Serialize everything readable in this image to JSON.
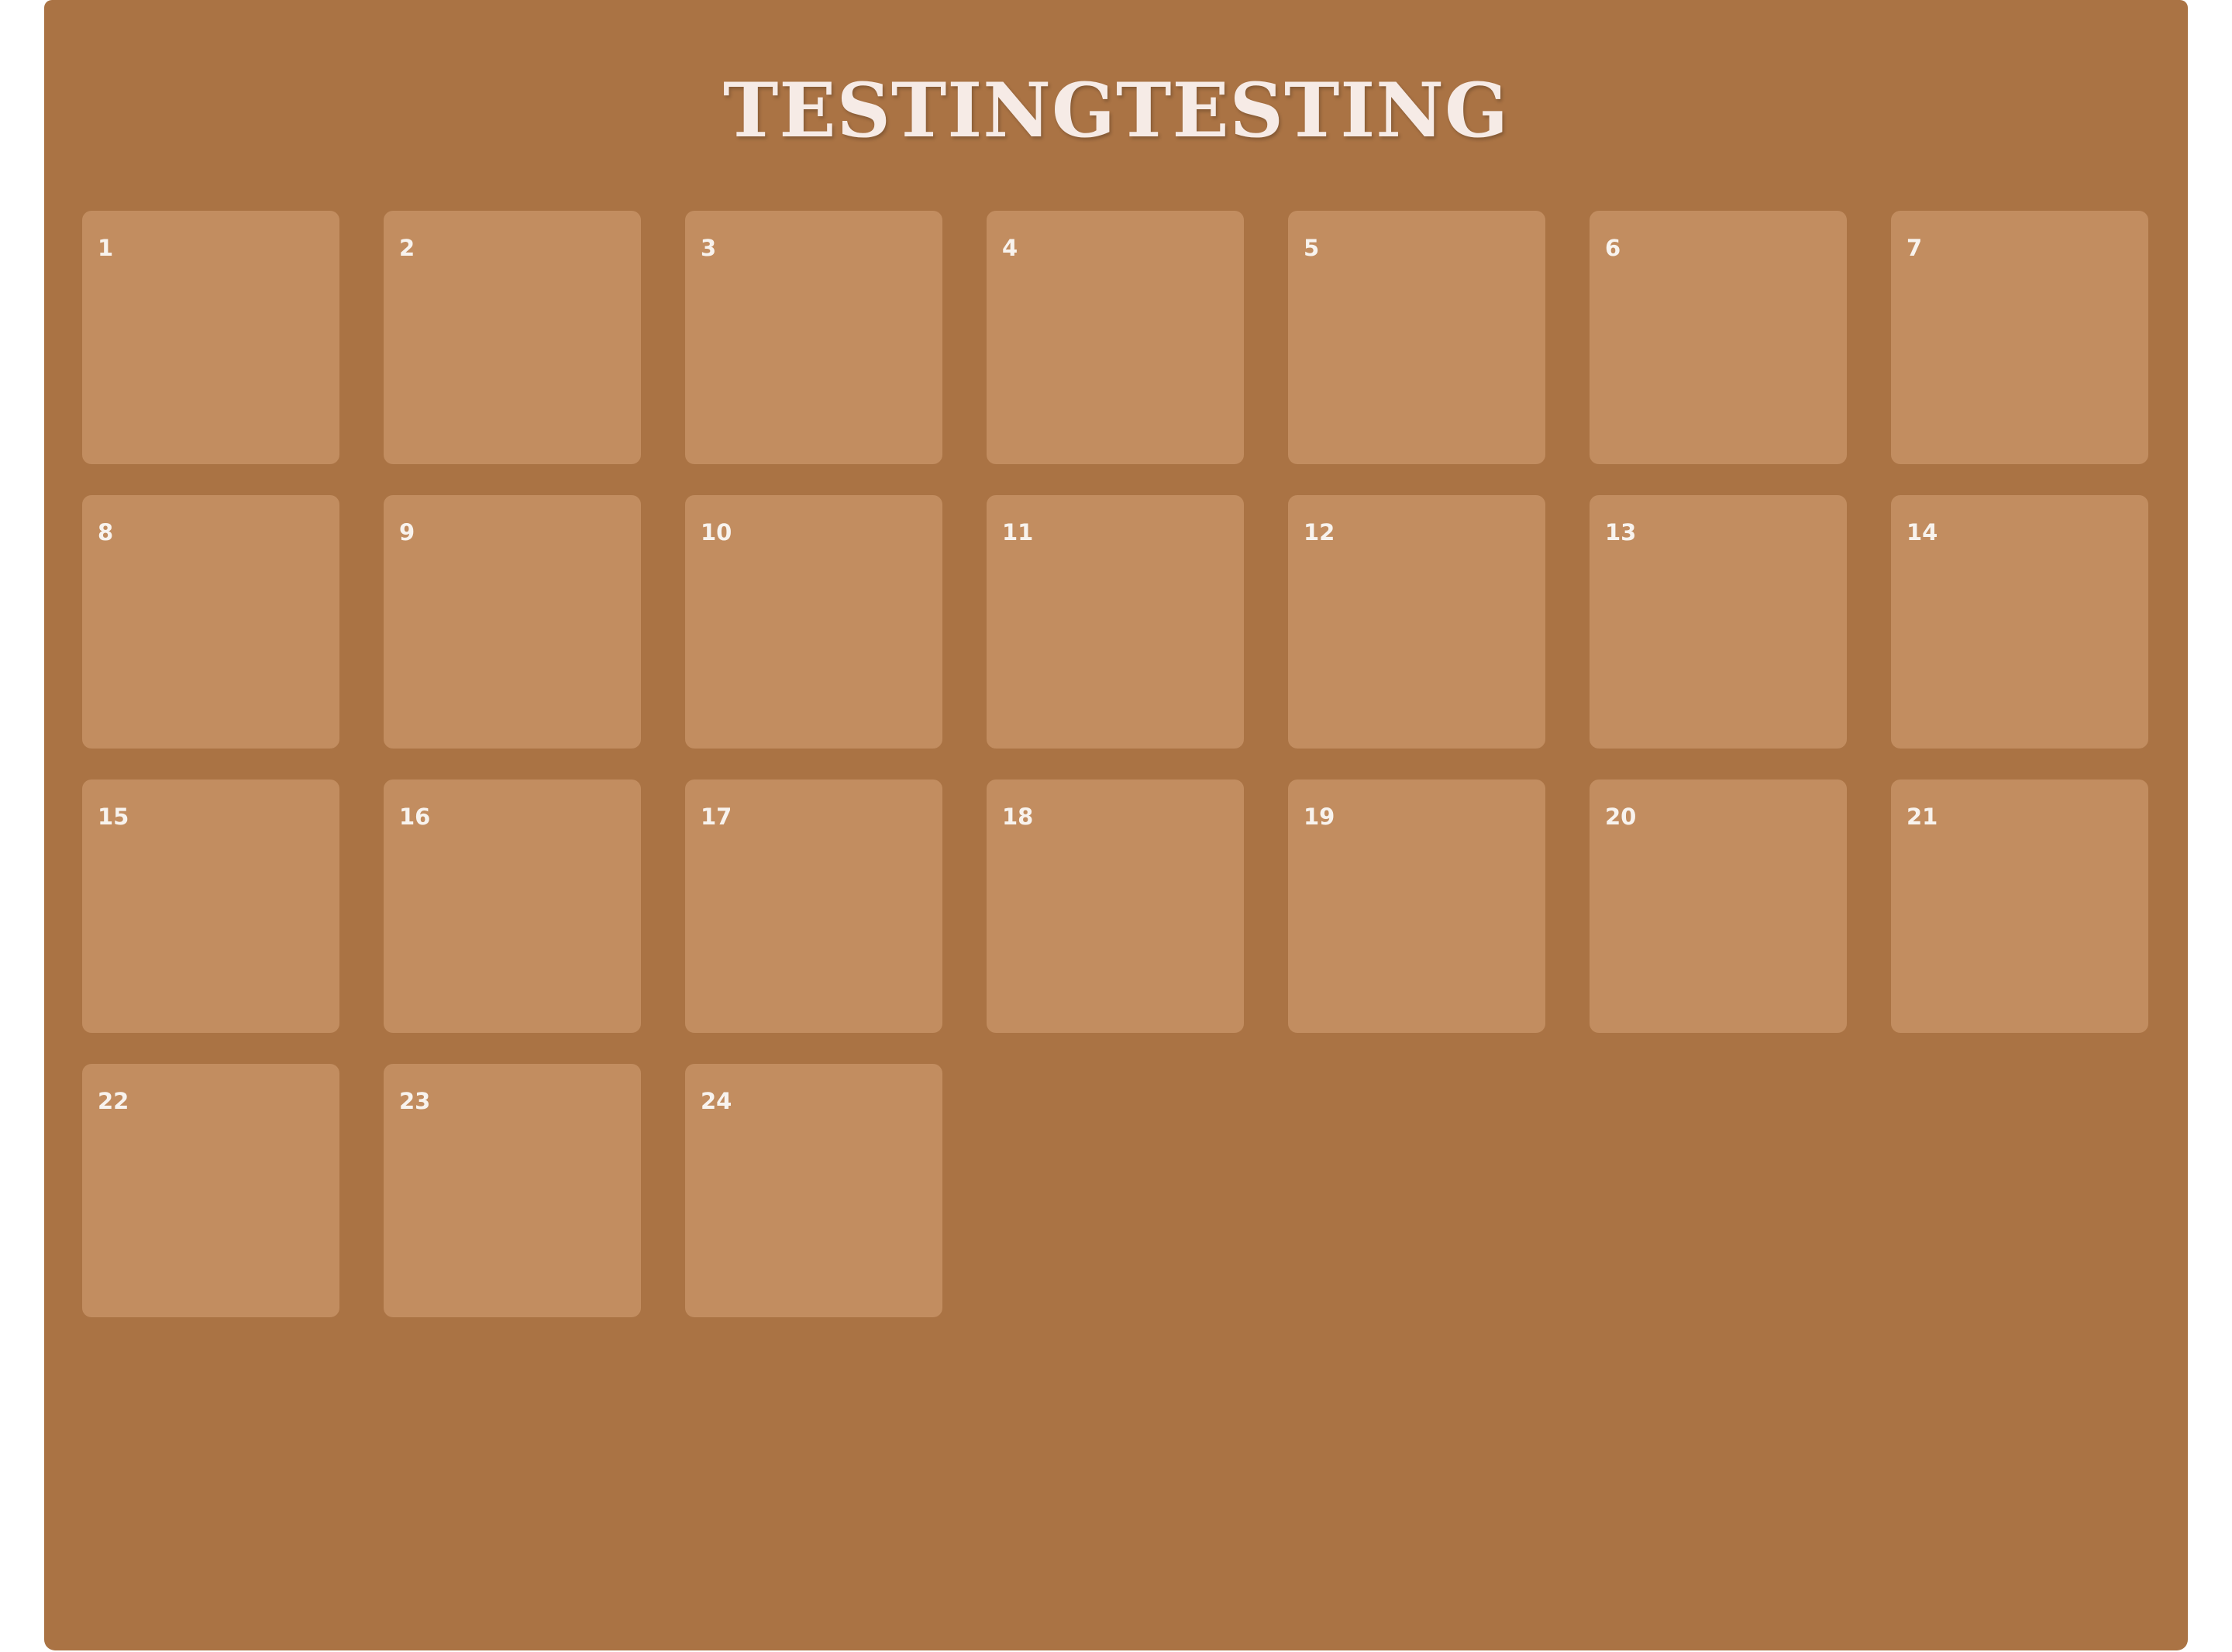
{
  "title": "TESTINGTESTING",
  "colors": {
    "panel": "#aa7344",
    "cell": "#c28d60",
    "text": "#f6ebe6"
  },
  "days": [
    "1",
    "2",
    "3",
    "4",
    "5",
    "6",
    "7",
    "8",
    "9",
    "10",
    "11",
    "12",
    "13",
    "14",
    "15",
    "16",
    "17",
    "18",
    "19",
    "20",
    "21",
    "22",
    "23",
    "24"
  ]
}
